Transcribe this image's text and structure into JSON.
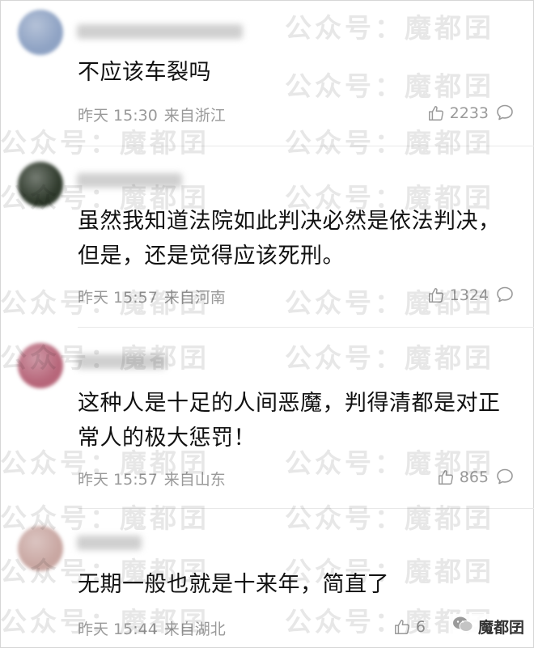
{
  "watermark": "公众号：魔都囝",
  "source_badge": "魔都囝",
  "comments": [
    {
      "text": "不应该车裂吗",
      "time": "昨天 15:30",
      "location": "来自浙江",
      "likes": "2233",
      "avatar_color": "#8fa3c4"
    },
    {
      "text": "虽然我知道法院如此判决必然是依法判决，但是，还是觉得应该死刑。",
      "time": "昨天 15:57",
      "location": "来自河南",
      "likes": "1324",
      "avatar_color": "#2f3a2c"
    },
    {
      "text": "这种人是十足的人间恶魔，判得清都是对正常人的极大惩罚！",
      "time": "昨天 15:57",
      "location": "来自山东",
      "likes": "865",
      "avatar_color": "#b7667a"
    },
    {
      "text": "无期一般也就是十来年，简直了",
      "time": "昨天 15:44",
      "location": "来自湖北",
      "likes": "6",
      "avatar_color": "#c9a7a2"
    }
  ]
}
